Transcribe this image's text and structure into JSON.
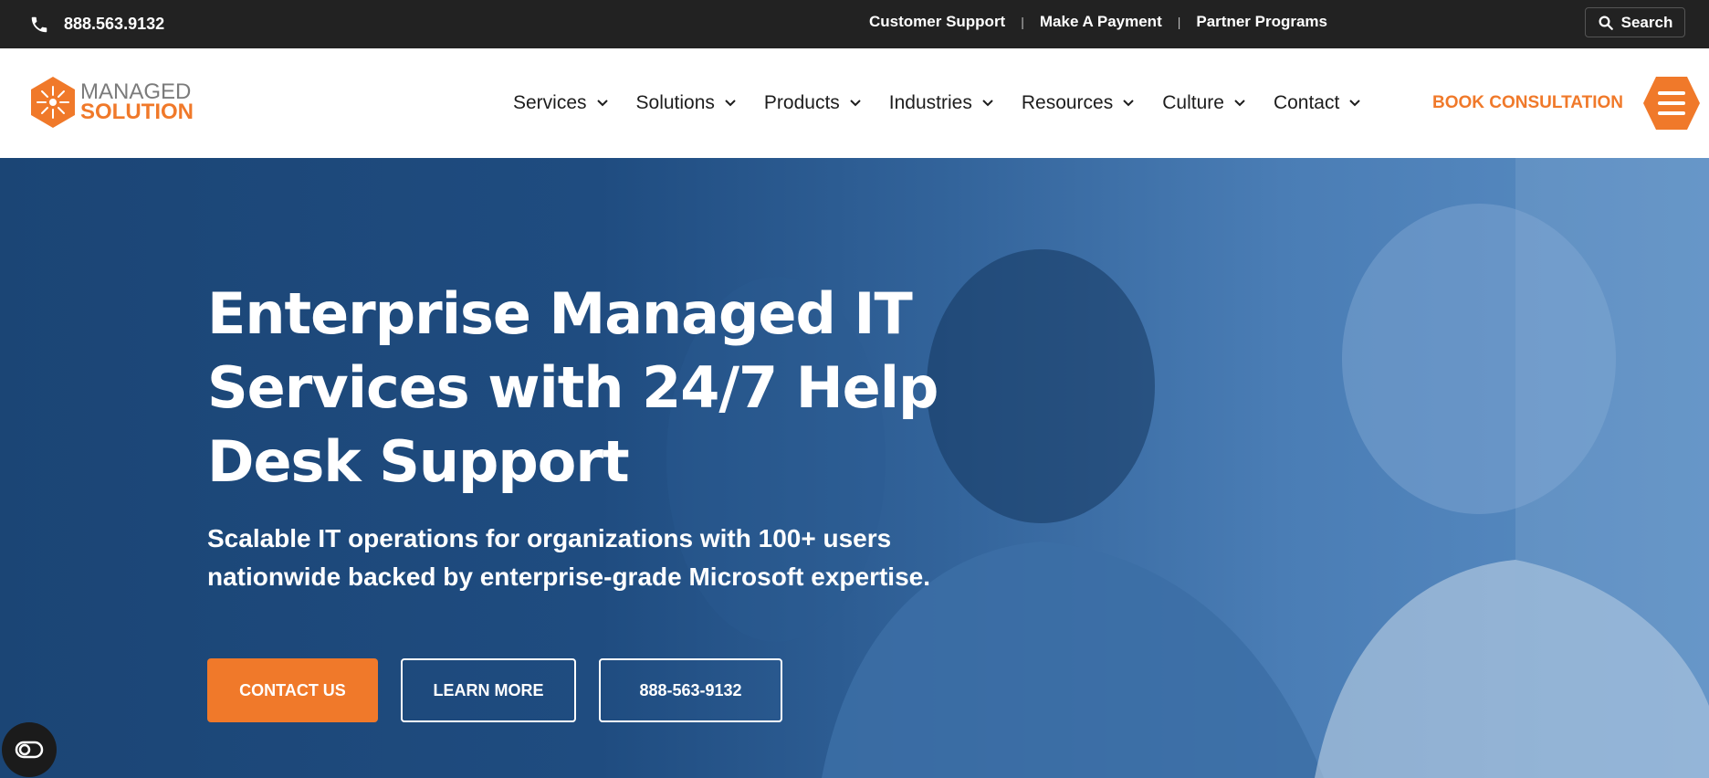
{
  "topbar": {
    "phone_icon": "phone-icon",
    "phone": "888.563.9132",
    "links": [
      "Customer Support",
      "Make A Payment",
      "Partner Programs"
    ],
    "search_label": "Search",
    "search_icon": "search-icon"
  },
  "logo": {
    "line1": "MANAGED",
    "line2": "SOLUTION",
    "brand_color": "#f0792a"
  },
  "nav": {
    "items": [
      {
        "label": "Services"
      },
      {
        "label": "Solutions"
      },
      {
        "label": "Products"
      },
      {
        "label": "Industries"
      },
      {
        "label": "Resources"
      },
      {
        "label": "Culture"
      },
      {
        "label": "Contact"
      }
    ],
    "cta": "BOOK CONSULTATION",
    "menu_icon": "hamburger-menu-icon"
  },
  "hero": {
    "title": "Enterprise Managed IT Services with 24/7 Help Desk Support",
    "subtitle": "Scalable IT operations for organizations with 100+ users nationwide backed by enterprise-grade Microsoft expertise.",
    "buttons": {
      "contact": "CONTACT US",
      "learn": "LEARN MORE",
      "phone": "888-563-9132"
    }
  },
  "accessibility_icon": "accessibility-toggle-icon"
}
